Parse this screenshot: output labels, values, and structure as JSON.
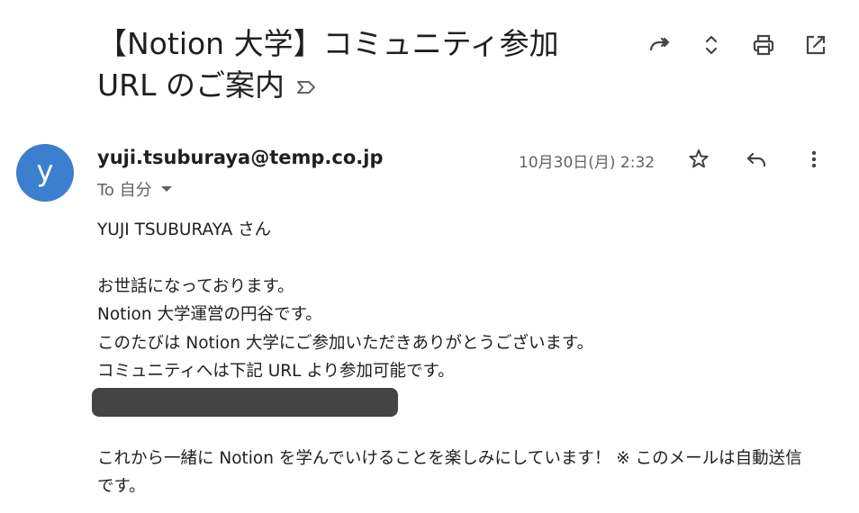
{
  "email": {
    "subject": "【Notion 大学】コミュニティ参加 URL のご案内",
    "sender": "yuji.tsuburaya@temp.co.jp",
    "avatar_letter": "y",
    "recipient": "To 自分",
    "datetime": "10月30日(月) 2:32",
    "body": {
      "greeting": "YUJI TSUBURAYA さん",
      "line1": "お世話になっております。",
      "line2": "Notion 大学運営の円谷です。",
      "line3": "このたびは Notion 大学にご参加いただきありがとうございます。",
      "line4": "コミュニティへは下記 URL より参加可能です。",
      "closing": "これから一緒に Notion を学んでいけることを楽しみにしています！ ※ このメールは自動送信です。"
    }
  },
  "icons": {
    "forward_all": "forward-all-icon",
    "expand": "expand-icon",
    "print": "print-icon",
    "open_new_window": "open-new-window-icon",
    "label": "label-icon",
    "star": "star-icon",
    "reply": "reply-icon",
    "more": "more-vert-icon"
  },
  "colors": {
    "avatar": "#3b7fce",
    "redacted": "#444444",
    "secondary_text": "#5f6368"
  }
}
